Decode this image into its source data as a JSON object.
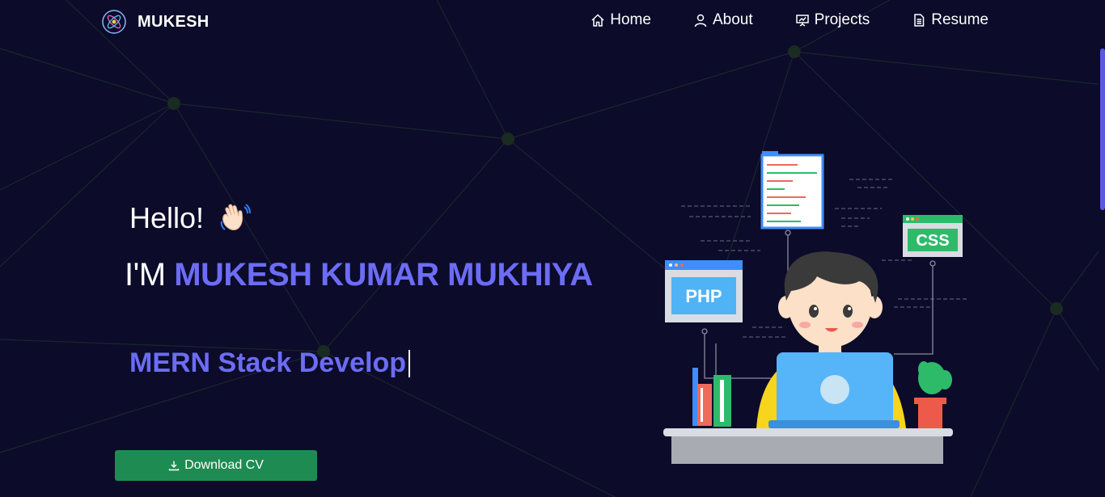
{
  "brand": {
    "name": "MUKESH",
    "logo_icon": "atom-logo-icon"
  },
  "nav": {
    "items": [
      {
        "label": "Home",
        "icon": "home-icon"
      },
      {
        "label": "About",
        "icon": "user-icon"
      },
      {
        "label": "Projects",
        "icon": "presentation-icon"
      },
      {
        "label": "Resume",
        "icon": "document-icon"
      }
    ]
  },
  "hero": {
    "greeting": "Hello!",
    "greeting_icon": "waving-hand-icon",
    "intro_prefix": "I'M ",
    "name": "MUKESH KUMAR MUKHIYA",
    "typed_role": "MERN Stack Develop",
    "download_label": "Download CV",
    "download_icon": "download-icon"
  },
  "illustration": {
    "php_label": "PHP",
    "css_label": "CSS"
  },
  "colors": {
    "background": "#0c0b2a",
    "accent": "#6c6cf5",
    "button": "#1e8b52"
  }
}
